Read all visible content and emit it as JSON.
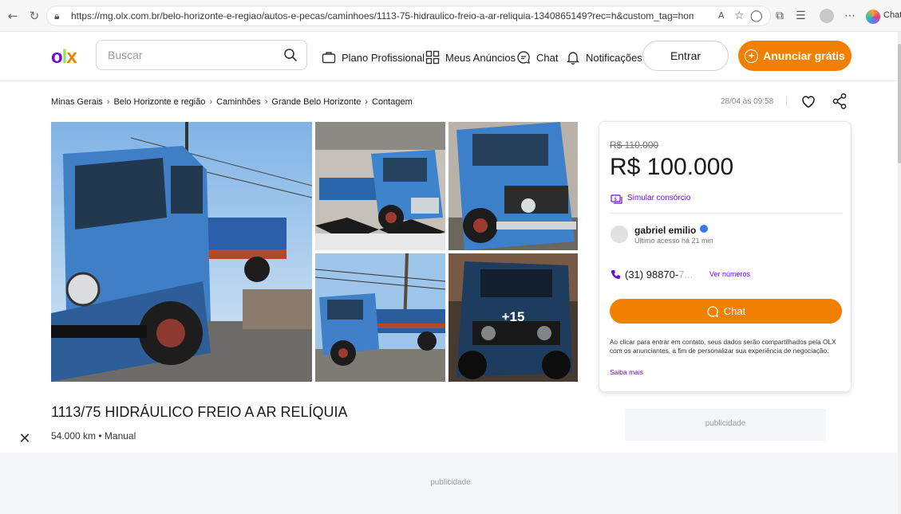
{
  "browser": {
    "url": "https://mg.olx.com.br/belo-horizonte-e-regiao/autos-e-pecas/caminhoes/1113-75-hidraulico-freio-a-ar-reliquia-1340865149?rec=h&custom_tag=homefeed&gall...",
    "copilot_label": "Chat"
  },
  "header": {
    "logo": {
      "o": "o",
      "l": "l",
      "x": "x"
    },
    "search_placeholder": "Buscar",
    "nav": {
      "plano": "Plano Profissional",
      "meus_anuncios": "Meus Anúncios",
      "chat": "Chat",
      "notificacoes": "Notificações"
    },
    "login_label": "Entrar",
    "announce_label": "Anunciar grátis"
  },
  "breadcrumb": [
    "Minas Gerais",
    "Belo Horizonte e região",
    "Caminhões",
    "Grande Belo Horizonte",
    "Contagem"
  ],
  "post_date": "28/04 às 09:58",
  "gallery": {
    "more_label": "+15"
  },
  "price_card": {
    "old_price": "R$ 110.000",
    "price": "R$ 100.000",
    "simulate": "Simular consórcio",
    "seller_name": "gabriel emilio",
    "last_seen": "Último acesso há 21 min",
    "phone_visible": "(31) 98870-",
    "phone_faded": "7...",
    "show_numbers": "Ver números",
    "chat_label": "Chat",
    "disclaimer": "Ao clicar para entrar em contato, seus dados serão compartilhados pela OLX com os anunciantes, a fim de personalizar sua experiência de negociação.",
    "learn_more": "Saiba mais"
  },
  "ad": {
    "title": "1113/75 HIDRÁULICO FREIO A AR RELÍQUIA",
    "specs": "54.000 km • Manual"
  },
  "ads": {
    "side_label": "publicidade",
    "bottom_label": "publicidade"
  },
  "colors": {
    "brand_purple": "#6e0ad6",
    "brand_orange": "#f28000",
    "brand_green": "#8ce563"
  }
}
